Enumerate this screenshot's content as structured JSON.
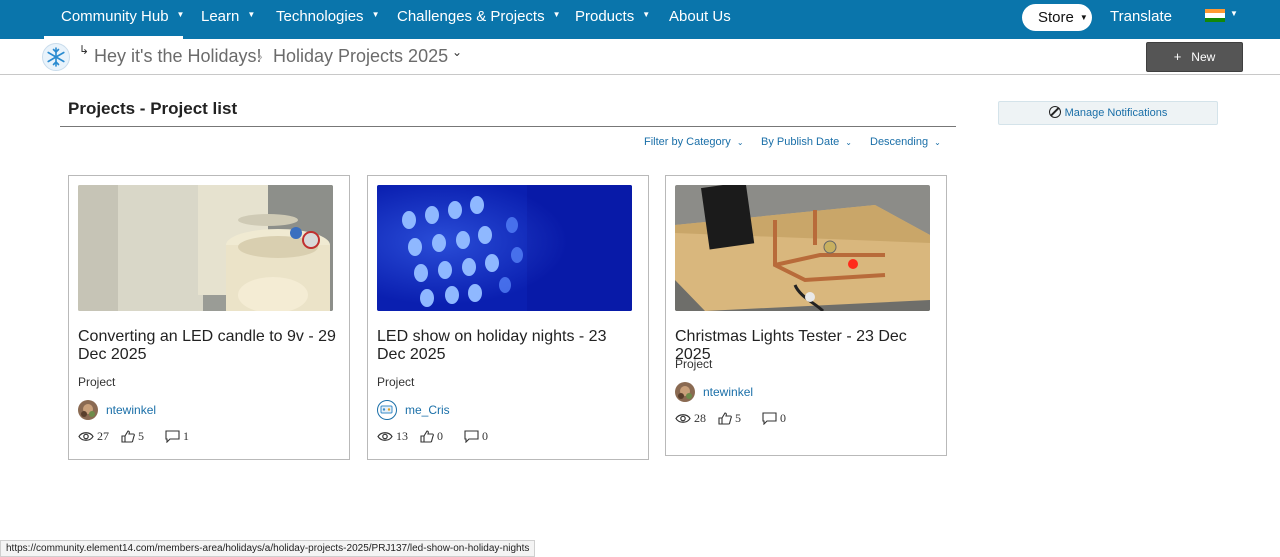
{
  "topnav": {
    "items": [
      {
        "label": "Community Hub",
        "has_menu": true
      },
      {
        "label": "Learn",
        "has_menu": true
      },
      {
        "label": "Technologies",
        "has_menu": true
      },
      {
        "label": "Challenges & Projects",
        "has_menu": true
      },
      {
        "label": "Products",
        "has_menu": true
      },
      {
        "label": "About Us",
        "has_menu": false
      }
    ],
    "store_label": "Store",
    "translate_label": "Translate",
    "flag_icon": "india-flag-icon",
    "colors": {
      "bar": "#0a75ab"
    }
  },
  "breadcrumb": {
    "parent_label": "Hey it's the Holidays!",
    "current_label": "Holiday Projects 2025",
    "new_button": "New"
  },
  "page": {
    "title": "Projects - Project list",
    "filters": {
      "category": "Filter by Category",
      "sort_by": "By Publish Date",
      "order": "Descending"
    },
    "manage_notifications": "Manage Notifications"
  },
  "cards": [
    {
      "title": "Converting an LED candle to 9v - 29 Dec 2025",
      "type": "Project",
      "author": "ntewinkel",
      "views": "27",
      "likes": "5",
      "comments": "1"
    },
    {
      "title": "LED show on holiday nights - 23 Dec 2025",
      "type": "Project",
      "author": "me_Cris",
      "views": "13",
      "likes": "0",
      "comments": "0"
    },
    {
      "title": "Christmas Lights Tester - 23 Dec 2025",
      "type": "Project",
      "author": "ntewinkel",
      "views": "28",
      "likes": "5",
      "comments": "0"
    }
  ],
  "status_bar": {
    "url": "https://community.element14.com/members-area/holidays/a/holiday-projects-2025/PRJ137/led-show-on-holiday-nights"
  }
}
